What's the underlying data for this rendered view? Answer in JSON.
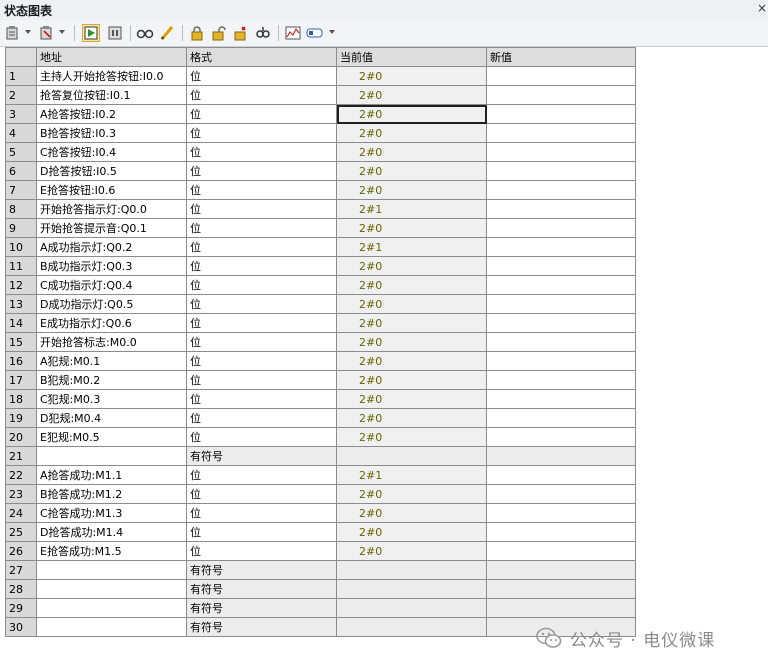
{
  "window": {
    "title": "状态图表",
    "close_glyph": "×"
  },
  "toolbar": {
    "icons": [
      "insert-icon",
      "delete-icon",
      "trend-start-icon",
      "pause-icon",
      "glasses-icon",
      "pencil-icon",
      "lock-icon",
      "unlock-icon",
      "unlock-all-icon",
      "read-forced-icon",
      "trend-view-icon",
      "tag-icon"
    ]
  },
  "table": {
    "headers": [
      "地址",
      "格式",
      "当前值",
      "新值"
    ],
    "rows": [
      {
        "n": "1",
        "addr": "主持人开始抢答按钮:I0.0",
        "fmt": "位",
        "cur": "2#0",
        "new": ""
      },
      {
        "n": "2",
        "addr": "抢答复位按钮:I0.1",
        "fmt": "位",
        "cur": "2#0",
        "new": ""
      },
      {
        "n": "3",
        "addr": "A抢答按钮:I0.2",
        "fmt": "位",
        "cur": "2#0",
        "new": ""
      },
      {
        "n": "4",
        "addr": "B抢答按钮:I0.3",
        "fmt": "位",
        "cur": "2#0",
        "new": ""
      },
      {
        "n": "5",
        "addr": "C抢答按钮:I0.4",
        "fmt": "位",
        "cur": "2#0",
        "new": ""
      },
      {
        "n": "6",
        "addr": "D抢答按钮:I0.5",
        "fmt": "位",
        "cur": "2#0",
        "new": ""
      },
      {
        "n": "7",
        "addr": "E抢答按钮:I0.6",
        "fmt": "位",
        "cur": "2#0",
        "new": ""
      },
      {
        "n": "8",
        "addr": "开始抢答指示灯:Q0.0",
        "fmt": "位",
        "cur": "2#1",
        "new": ""
      },
      {
        "n": "9",
        "addr": "开始抢答提示音:Q0.1",
        "fmt": "位",
        "cur": "2#0",
        "new": ""
      },
      {
        "n": "10",
        "addr": "A成功指示灯:Q0.2",
        "fmt": "位",
        "cur": "2#1",
        "new": ""
      },
      {
        "n": "11",
        "addr": "B成功指示灯:Q0.3",
        "fmt": "位",
        "cur": "2#0",
        "new": ""
      },
      {
        "n": "12",
        "addr": "C成功指示灯:Q0.4",
        "fmt": "位",
        "cur": "2#0",
        "new": ""
      },
      {
        "n": "13",
        "addr": "D成功指示灯:Q0.5",
        "fmt": "位",
        "cur": "2#0",
        "new": ""
      },
      {
        "n": "14",
        "addr": "E成功指示灯:Q0.6",
        "fmt": "位",
        "cur": "2#0",
        "new": ""
      },
      {
        "n": "15",
        "addr": "开始抢答标志:M0.0",
        "fmt": "位",
        "cur": "2#0",
        "new": ""
      },
      {
        "n": "16",
        "addr": "A犯规:M0.1",
        "fmt": "位",
        "cur": "2#0",
        "new": ""
      },
      {
        "n": "17",
        "addr": "B犯规:M0.2",
        "fmt": "位",
        "cur": "2#0",
        "new": ""
      },
      {
        "n": "18",
        "addr": "C犯规:M0.3",
        "fmt": "位",
        "cur": "2#0",
        "new": ""
      },
      {
        "n": "19",
        "addr": "D犯规:M0.4",
        "fmt": "位",
        "cur": "2#0",
        "new": ""
      },
      {
        "n": "20",
        "addr": "E犯规:M0.5",
        "fmt": "位",
        "cur": "2#0",
        "new": ""
      },
      {
        "n": "21",
        "addr": "",
        "fmt": "有符号",
        "cur": "",
        "new": ""
      },
      {
        "n": "22",
        "addr": "A抢答成功:M1.1",
        "fmt": "位",
        "cur": "2#1",
        "new": ""
      },
      {
        "n": "23",
        "addr": "B抢答成功:M1.2",
        "fmt": "位",
        "cur": "2#0",
        "new": ""
      },
      {
        "n": "24",
        "addr": "C抢答成功:M1.3",
        "fmt": "位",
        "cur": "2#0",
        "new": ""
      },
      {
        "n": "25",
        "addr": "D抢答成功:M1.4",
        "fmt": "位",
        "cur": "2#0",
        "new": ""
      },
      {
        "n": "26",
        "addr": "E抢答成功:M1.5",
        "fmt": "位",
        "cur": "2#0",
        "new": ""
      },
      {
        "n": "27",
        "addr": "",
        "fmt": "有符号",
        "cur": "",
        "new": ""
      },
      {
        "n": "28",
        "addr": "",
        "fmt": "有符号",
        "cur": "",
        "new": ""
      },
      {
        "n": "29",
        "addr": "",
        "fmt": "有符号",
        "cur": "",
        "new": ""
      },
      {
        "n": "30",
        "addr": "",
        "fmt": "有符号",
        "cur": "",
        "new": ""
      }
    ]
  },
  "watermark": {
    "text": "公众号 · 电仪微课"
  },
  "colors": {
    "value_text": "#6b6200",
    "header_bg": "#dddddd",
    "toolbar_active": "#fde9a6"
  }
}
